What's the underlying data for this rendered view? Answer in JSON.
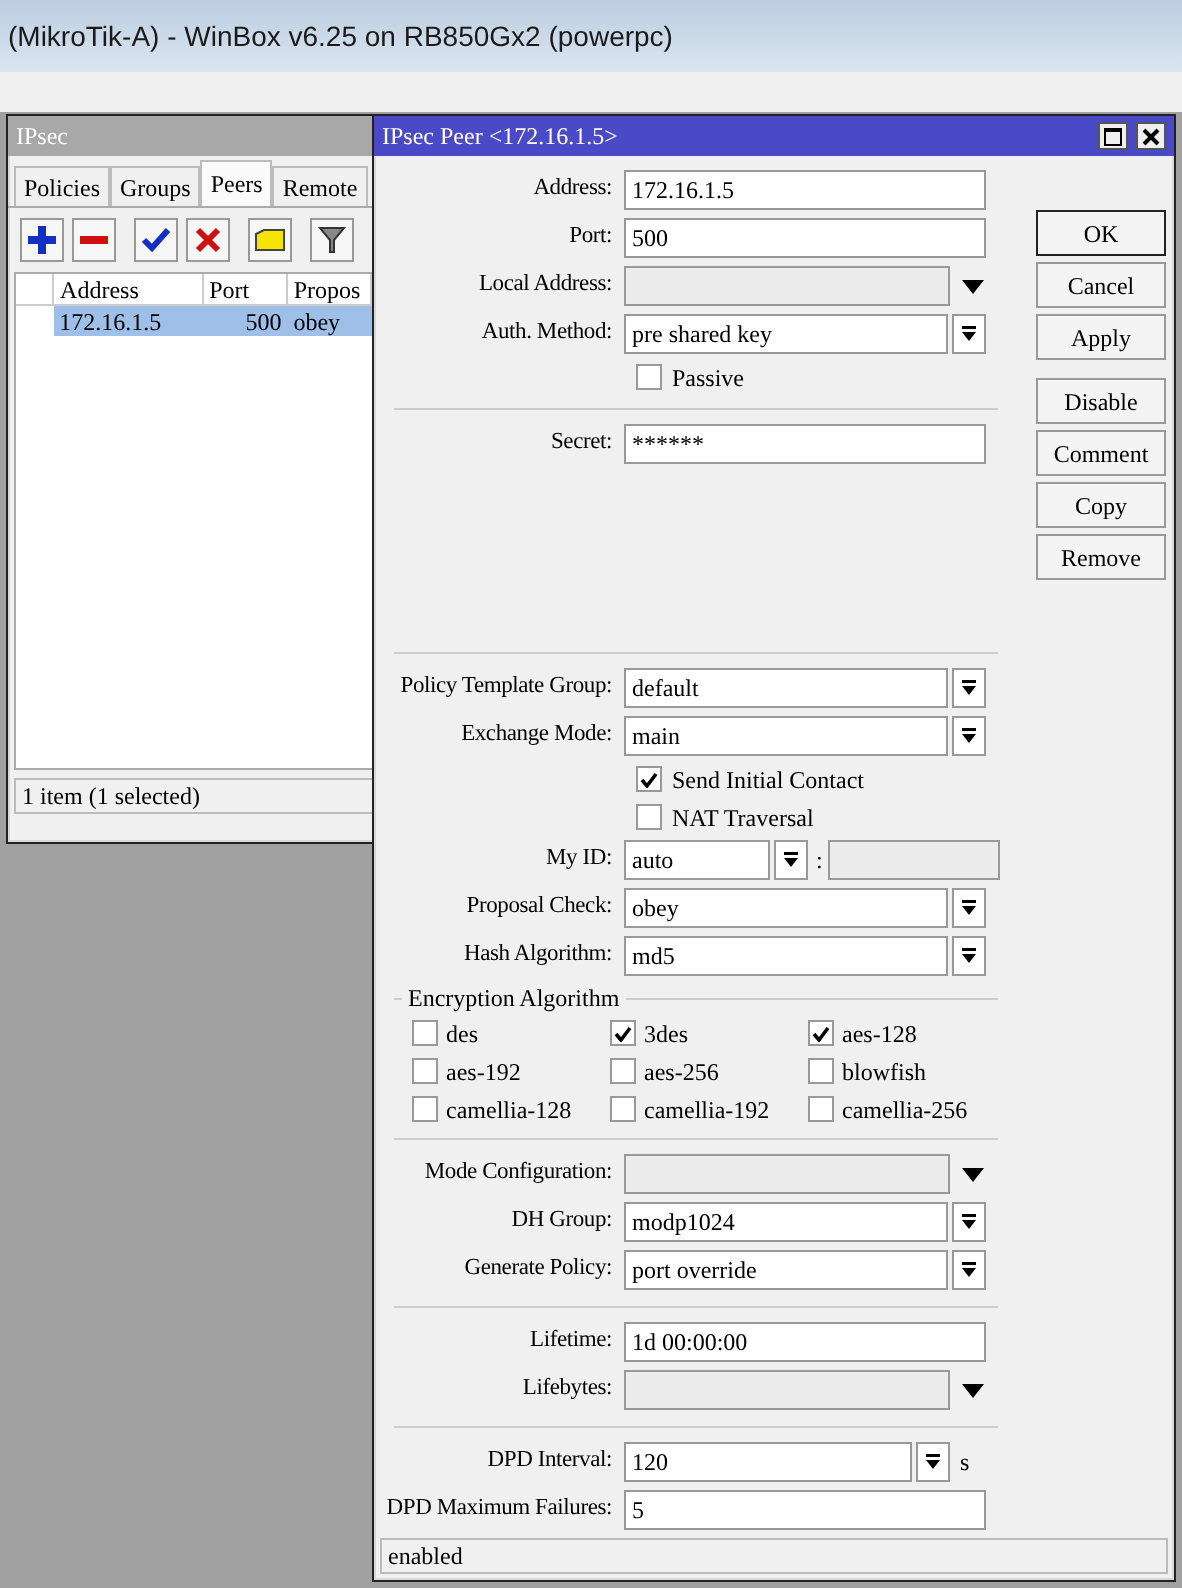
{
  "app_title": "(MikroTik-A) - WinBox v6.25 on RB850Gx2 (powerpc)",
  "ipsec_window": {
    "title": "IPsec",
    "tabs": [
      {
        "label": "Policies",
        "selected": false
      },
      {
        "label": "Groups",
        "selected": false
      },
      {
        "label": "Peers",
        "selected": true
      },
      {
        "label": "Remote",
        "selected": false
      }
    ],
    "table": {
      "columns": [
        "Address",
        "Port",
        "Propos"
      ],
      "rows": [
        {
          "cells": [
            "172.16.1.5",
            "500",
            "obey"
          ],
          "selected": true
        }
      ]
    },
    "status_bar": "1 item (1 selected)"
  },
  "peer_dialog": {
    "title": "IPsec Peer <172.16.1.5>",
    "fields": [
      {
        "kind": "text",
        "label": "Address:",
        "value": "172.16.1.5"
      },
      {
        "kind": "text",
        "label": "Port:",
        "value": "500"
      },
      {
        "kind": "optional",
        "label": "Local Address:"
      },
      {
        "kind": "select",
        "label": "Auth. Method:",
        "value": "pre shared key"
      },
      {
        "kind": "check",
        "label": "Passive",
        "checked": false
      },
      {
        "kind": "divider"
      },
      {
        "kind": "text",
        "label": "Secret:",
        "value": "******"
      },
      {
        "kind": "gap"
      },
      {
        "kind": "divider"
      },
      {
        "kind": "select",
        "label": "Policy Template Group:",
        "value": "default"
      },
      {
        "kind": "select",
        "label": "Exchange Mode:",
        "value": "main"
      },
      {
        "kind": "check",
        "label": "Send Initial Contact",
        "checked": true
      },
      {
        "kind": "check",
        "label": "NAT Traversal",
        "checked": false
      },
      {
        "kind": "pair",
        "label": "My ID:",
        "value": "auto",
        "separator": ":"
      },
      {
        "kind": "select",
        "label": "Proposal Check:",
        "value": "obey"
      },
      {
        "kind": "select",
        "label": "Hash Algorithm:",
        "value": "md5"
      },
      {
        "kind": "group",
        "title": "Encryption Algorithm",
        "options": [
          {
            "label": "des",
            "checked": false
          },
          {
            "label": "3des",
            "checked": true
          },
          {
            "label": "aes-128",
            "checked": true
          },
          {
            "label": "aes-192",
            "checked": false
          },
          {
            "label": "aes-256",
            "checked": false
          },
          {
            "label": "blowfish",
            "checked": false
          },
          {
            "label": "camellia-128",
            "checked": false
          },
          {
            "label": "camellia-192",
            "checked": false
          },
          {
            "label": "camellia-256",
            "checked": false
          }
        ]
      },
      {
        "kind": "divider"
      },
      {
        "kind": "optional",
        "label": "Mode Configuration:"
      },
      {
        "kind": "select",
        "label": "DH Group:",
        "value": "modp1024"
      },
      {
        "kind": "select",
        "label": "Generate Policy:",
        "value": "port override"
      },
      {
        "kind": "divider"
      },
      {
        "kind": "text",
        "label": "Lifetime:",
        "value": "1d 00:00:00"
      },
      {
        "kind": "optional",
        "label": "Lifebytes:"
      },
      {
        "kind": "divider"
      },
      {
        "kind": "select",
        "label": "DPD Interval:",
        "value": "120",
        "unit": "s"
      },
      {
        "kind": "text",
        "label": "DPD Maximum Failures:",
        "value": "5"
      }
    ],
    "button_groups": [
      [
        {
          "label": "OK",
          "default": true
        },
        {
          "label": "Cancel",
          "default": false
        },
        {
          "label": "Apply",
          "default": false
        }
      ],
      [
        {
          "label": "Disable",
          "default": false
        },
        {
          "label": "Comment",
          "default": false
        },
        {
          "label": "Copy",
          "default": false
        },
        {
          "label": "Remove",
          "default": false
        }
      ]
    ],
    "status_bar": "enabled"
  }
}
